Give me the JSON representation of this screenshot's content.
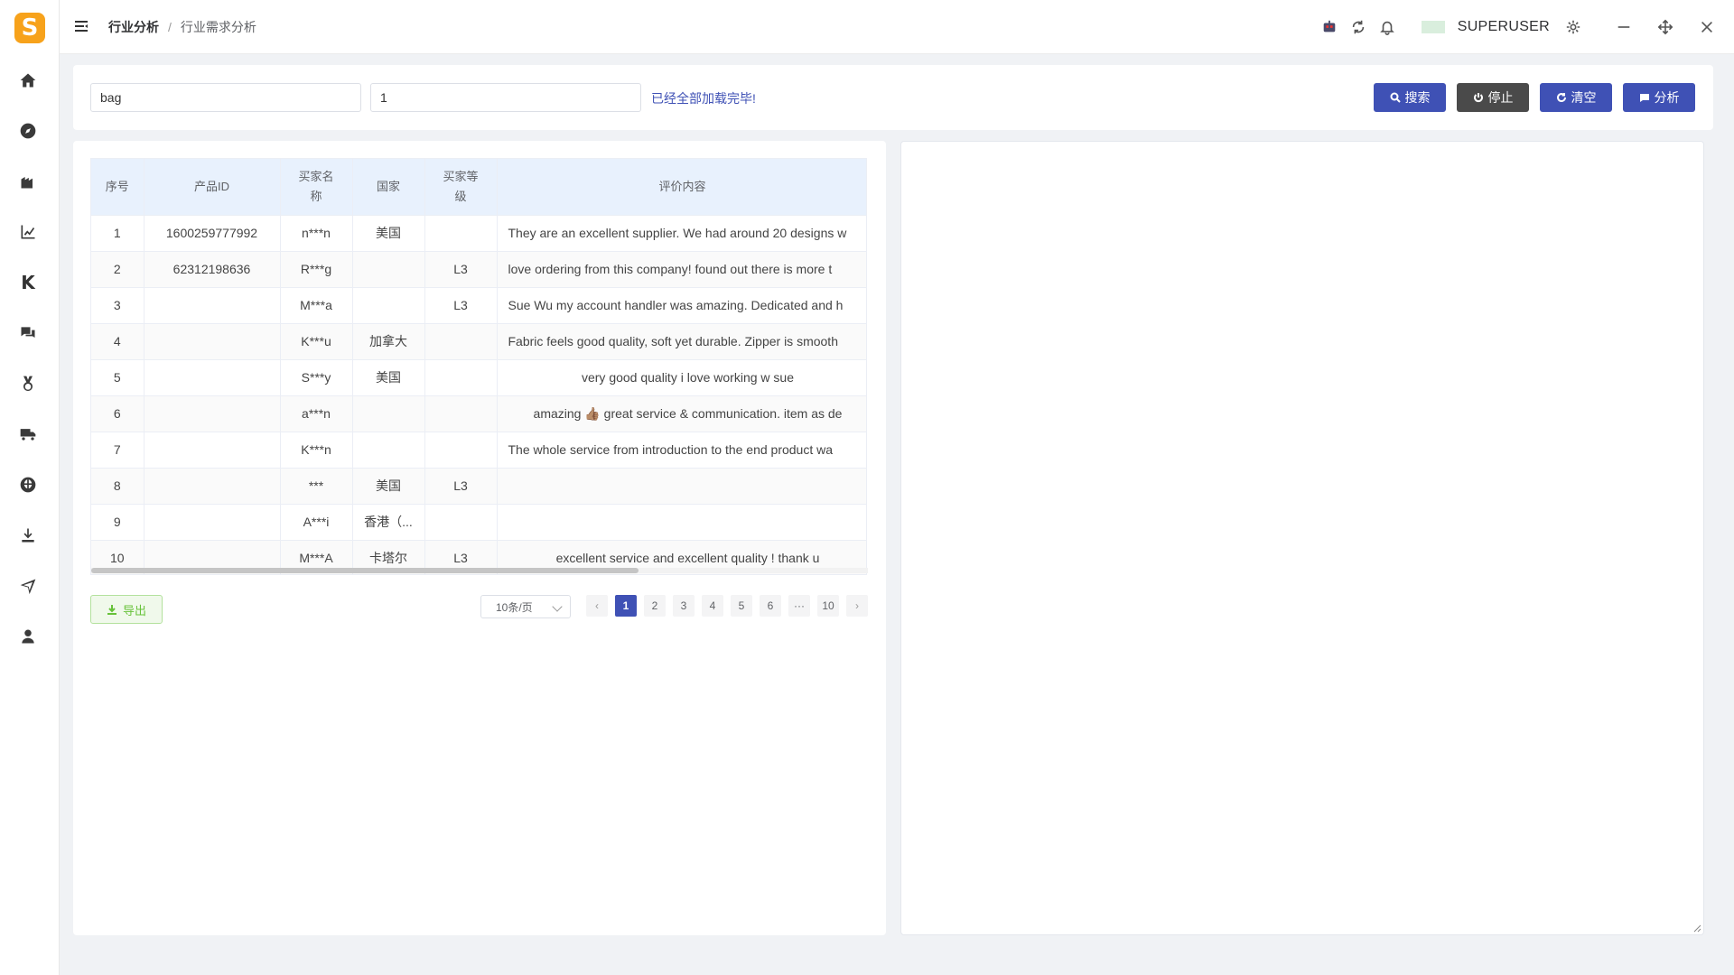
{
  "app": {
    "logo_letter": "S",
    "username": "SUPERUSER"
  },
  "breadcrumb": {
    "parent": "行业分析",
    "separator": "/",
    "current": "行业需求分析"
  },
  "sidebar": {
    "items": [
      {
        "icon": "home-icon"
      },
      {
        "icon": "compass-icon"
      },
      {
        "icon": "building-icon"
      },
      {
        "icon": "line-chart-icon"
      },
      {
        "icon": "k-icon",
        "label": "K"
      },
      {
        "icon": "chat-icon"
      },
      {
        "icon": "medal-icon"
      },
      {
        "icon": "shipping-icon"
      },
      {
        "icon": "globe-icon"
      },
      {
        "icon": "download-icon"
      },
      {
        "icon": "send-icon"
      },
      {
        "icon": "user-icon"
      }
    ]
  },
  "search": {
    "keyword_value": "bag",
    "page_value": "1",
    "status": "已经全部加载完毕!",
    "buttons": {
      "search": "搜索",
      "stop": "停止",
      "clear": "清空",
      "analyze": "分析"
    }
  },
  "table": {
    "headers": {
      "index": "序号",
      "product_id": "产品ID",
      "buyer_name": "买家名称",
      "country": "国家",
      "buyer_level": "买家等级",
      "review": "评价内容"
    },
    "rows": [
      {
        "index": "1",
        "product_id": "1600259777992",
        "buyer_name": "n***n",
        "country": "美国",
        "buyer_level": "",
        "review": "They are an excellent supplier. We had around 20 designs w",
        "align": "left"
      },
      {
        "index": "2",
        "product_id": "62312198636",
        "buyer_name": "R***g",
        "country": "",
        "buyer_level": "L3",
        "review": "love ordering from this company! found out there is more t",
        "align": "left"
      },
      {
        "index": "3",
        "product_id": "",
        "buyer_name": "M***a",
        "country": "",
        "buyer_level": "L3",
        "review": "Sue Wu my account handler was amazing. Dedicated and h",
        "align": "left"
      },
      {
        "index": "4",
        "product_id": "",
        "buyer_name": "K***u",
        "country": "加拿大",
        "buyer_level": "",
        "review": "Fabric feels good quality, soft yet durable. Zipper is smooth",
        "align": "left"
      },
      {
        "index": "5",
        "product_id": "",
        "buyer_name": "S***y",
        "country": "美国",
        "buyer_level": "",
        "review": "very good quality i love working w sue",
        "align": "center"
      },
      {
        "index": "6",
        "product_id": "",
        "buyer_name": "a***n",
        "country": "",
        "buyer_level": "",
        "review": "amazing 👍🏽 great service & communication. item as de",
        "align": "center"
      },
      {
        "index": "7",
        "product_id": "",
        "buyer_name": "K***n",
        "country": "",
        "buyer_level": "",
        "review": "The whole service from introduction to the end product wa",
        "align": "left"
      },
      {
        "index": "8",
        "product_id": "",
        "buyer_name": "***",
        "country": "美国",
        "buyer_level": "L3",
        "review": "",
        "align": "left"
      },
      {
        "index": "9",
        "product_id": "",
        "buyer_name": "A***i",
        "country": "香港（...",
        "buyer_level": "",
        "review": "",
        "align": "left"
      },
      {
        "index": "10",
        "product_id": "",
        "buyer_name": "M***A",
        "country": "卡塔尔",
        "buyer_level": "L3",
        "review": "excellent service and excellent quality ! thank u",
        "align": "center"
      }
    ]
  },
  "export_label": "导出",
  "pagination": {
    "page_size": "10条/页",
    "pages": [
      "1",
      "2",
      "3",
      "4",
      "5",
      "6",
      "···",
      "10"
    ],
    "current": "1"
  }
}
